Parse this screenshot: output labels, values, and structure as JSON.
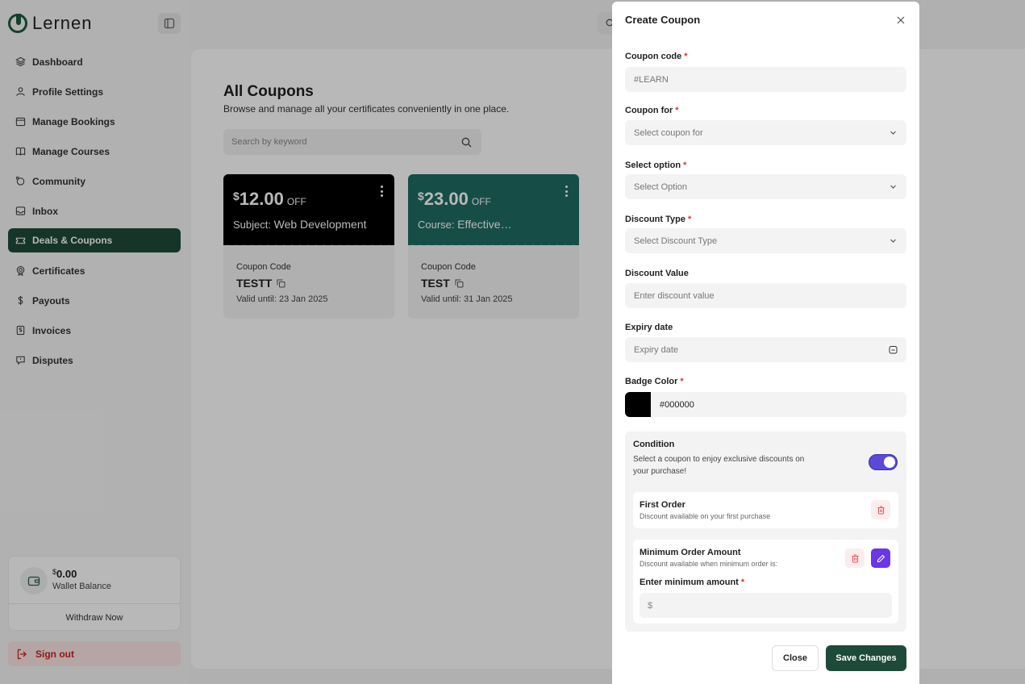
{
  "app": {
    "logo_text": "Lernen"
  },
  "sidebar": {
    "items": [
      {
        "label": "Dashboard",
        "icon": "layers-icon"
      },
      {
        "label": "Profile Settings",
        "icon": "user-icon"
      },
      {
        "label": "Manage Bookings",
        "icon": "calendar-icon"
      },
      {
        "label": "Manage Courses",
        "icon": "book-icon"
      },
      {
        "label": "Community",
        "icon": "community-icon"
      },
      {
        "label": "Inbox",
        "icon": "inbox-icon"
      },
      {
        "label": "Deals & Coupons",
        "icon": "ticket-icon",
        "active": true
      },
      {
        "label": "Certificates",
        "icon": "certificate-icon"
      },
      {
        "label": "Payouts",
        "icon": "dollar-icon"
      },
      {
        "label": "Invoices",
        "icon": "invoice-icon"
      },
      {
        "label": "Disputes",
        "icon": "dispute-icon"
      }
    ],
    "wallet": {
      "currency": "$",
      "amount": "0.00",
      "label": "Wallet Balance",
      "withdraw_label": "Withdraw Now"
    },
    "signout_label": "Sign out"
  },
  "main": {
    "title": "All Coupons",
    "subtitle": "Browse and manage all your certificates conveniently in one place.",
    "search_placeholder": "Search by keyword",
    "coupons": [
      {
        "currency": "$",
        "amount": "12.00",
        "off": "OFF",
        "subject_label": "Subject:",
        "subject_value": "Web Development",
        "code_label": "Coupon Code",
        "code": "TESTT",
        "valid": "Valid until: 23 Jan 2025",
        "color": "#000000"
      },
      {
        "currency": "$",
        "amount": "23.00",
        "off": "OFF",
        "subject_label": "Course:",
        "subject_value": "Effective…",
        "code_label": "Coupon Code",
        "code": "TEST",
        "valid": "Valid until: 31 Jan 2025",
        "color": "#1f6b63"
      }
    ]
  },
  "modal": {
    "title": "Create Coupon",
    "coupon_code": {
      "label": "Coupon code",
      "placeholder": "#LEARN"
    },
    "coupon_for": {
      "label": "Coupon for",
      "value": "Select coupon for"
    },
    "select_option": {
      "label": "Select option",
      "value": "Select Option"
    },
    "discount_type": {
      "label": "Discount Type",
      "value": "Select Discount Type"
    },
    "discount_value": {
      "label": "Discount Value",
      "placeholder": "Enter discount value"
    },
    "expiry": {
      "label": "Expiry date",
      "placeholder": "Expiry date"
    },
    "badge_color": {
      "label": "Badge Color",
      "value": "#000000"
    },
    "required_mark": "*",
    "condition": {
      "title": "Condition",
      "description": "Select a coupon to enjoy exclusive discounts on your purchase!",
      "toggle_on": true,
      "first_order": {
        "title": "First Order",
        "desc": "Discount available on your first purchase"
      },
      "min_order": {
        "title": "Minimum Order Amount",
        "desc": "Discount available when minimum order is:",
        "input_label": "Enter minimum amount",
        "input_prefix": "$"
      }
    },
    "close_label": "Close",
    "save_label": "Save Changes"
  },
  "colors": {
    "brand": "#1e4a3a",
    "accent": "#5b4ad8",
    "danger": "#cc2222"
  }
}
